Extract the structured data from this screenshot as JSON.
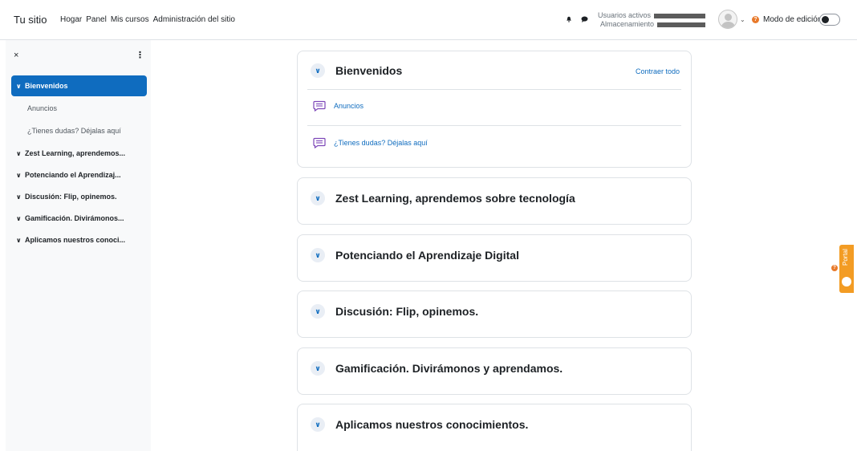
{
  "topnav": {
    "brand": "Tu sitio",
    "links": [
      "Hogar",
      "Panel",
      "Mis cursos",
      "Administración del sitio"
    ],
    "stats": {
      "active_users_label": "Usuarios activos",
      "storage_label": "Almacenamiento"
    },
    "help_badge": "?",
    "edit_mode_label": "Modo de edición",
    "edit_mode_on": false
  },
  "drawer": {
    "close_glyph": "×",
    "menu_glyph": "⋮",
    "items": [
      {
        "label": "Bienvenidos",
        "type": "section",
        "active": true
      },
      {
        "label": "Anuncios",
        "type": "activity"
      },
      {
        "label": "¿Tienes dudas? Déjalas aquí",
        "type": "activity"
      },
      {
        "label": "Zest Learning, aprendemos...",
        "type": "section"
      },
      {
        "label": "Potenciando el Aprendizaj...",
        "type": "section"
      },
      {
        "label": "Discusión: Flip, opinemos.",
        "type": "section"
      },
      {
        "label": "Gamificación. Divirámonos...",
        "type": "section"
      },
      {
        "label": "Aplicamos nuestros conoci...",
        "type": "section"
      }
    ]
  },
  "course": {
    "collapse_all": "Contraer todo",
    "sections": [
      {
        "title": "Bienvenidos",
        "activities": [
          "Anuncios",
          "¿Tienes dudas? Déjalas aquí"
        ]
      },
      {
        "title": "Zest Learning, aprendemos sobre tecnología"
      },
      {
        "title": "Potenciando el Aprendizaje Digital"
      },
      {
        "title": "Discusión: Flip, opinemos."
      },
      {
        "title": "Gamificación. Divirámonos y aprendamos."
      },
      {
        "title": "Aplicamos nuestros conocimientos."
      }
    ]
  },
  "portal": {
    "label": "Portal",
    "badge": "?"
  },
  "icons": {
    "bell": "bell-icon",
    "chat": "chat-icon",
    "avatar": "user-avatar-icon",
    "chevron": "chevron-down-icon",
    "forum": "forum-icon",
    "close": "close-icon",
    "menu": "kebab-menu-icon"
  },
  "colors": {
    "primary": "#0f6cbf",
    "accent": "#e8792a",
    "portal": "#f39c24",
    "drawer_bg": "#f8f9fa"
  }
}
